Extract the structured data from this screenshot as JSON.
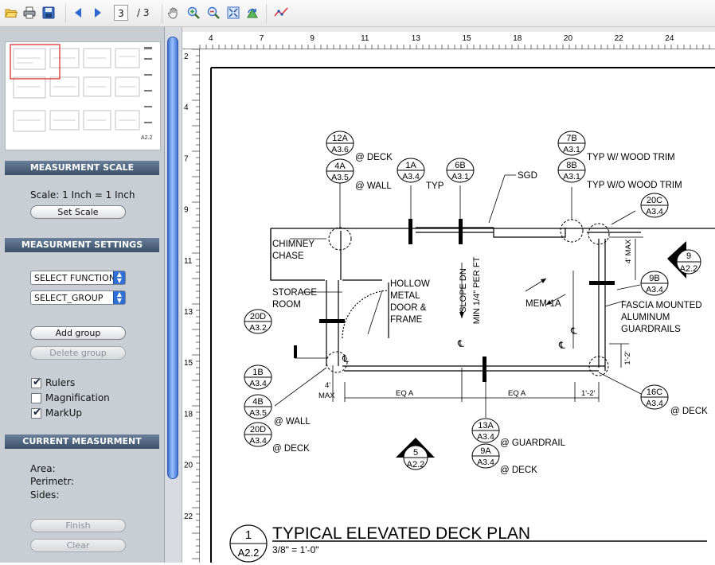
{
  "toolbar": {
    "current_page": "3",
    "total_pages": "/ 3",
    "icons": [
      "folder-open-icon",
      "print-icon",
      "save-icon",
      "previous-page-icon",
      "next-page-icon",
      "pan-hand-icon",
      "zoom-in-icon",
      "zoom-out-icon",
      "fit-page-icon",
      "rotate-icon",
      "measure-icon"
    ]
  },
  "thumbnail": {
    "sheet_label": "A2.2"
  },
  "measurement_scale": {
    "header": "MEASURMENT SCALE",
    "scale_text": "Scale: 1 Inch = 1 Inch",
    "set_scale_label": "Set Scale"
  },
  "measurement_settings": {
    "header": "MEASURMENT SETTINGS",
    "function_select": "SELECT FUNCTION",
    "group_select": "SELECT_GROUP",
    "add_group_label": "Add group",
    "delete_group_label": "Delete group",
    "checkboxes": [
      {
        "label": "Rulers",
        "checked": true
      },
      {
        "label": "Magnification",
        "checked": false
      },
      {
        "label": "MarkUp",
        "checked": true
      }
    ]
  },
  "current_measurement": {
    "header": "CURRENT MEASURMENT",
    "area_label": "Area:",
    "perimeter_label": "Perimetr:",
    "sides_label": "Sides:",
    "finish_label": "Finish",
    "clear_label": "Clear"
  },
  "rulers": {
    "top_labels": [
      "4",
      "7",
      "9",
      "11",
      "13",
      "15",
      "18",
      "20",
      "22",
      "24"
    ],
    "left_labels": [
      "2",
      "4",
      "7",
      "9",
      "11",
      "13",
      "15",
      "18",
      "20",
      "22"
    ]
  },
  "drawing": {
    "tags": [
      {
        "top": "12A",
        "bottom": "A3.6"
      },
      {
        "top": "4A",
        "bottom": "A3.5"
      },
      {
        "top": "1A",
        "bottom": "A3.4"
      },
      {
        "top": "6B",
        "bottom": "A3.1"
      },
      {
        "top": "7B",
        "bottom": "A3.1"
      },
      {
        "top": "8B",
        "bottom": "A3.1"
      },
      {
        "top": "20C",
        "bottom": "A3.4"
      },
      {
        "top": "9B",
        "bottom": "A3.4"
      },
      {
        "top": "20D",
        "bottom": "A3.2"
      },
      {
        "top": "1B",
        "bottom": "A3.4"
      },
      {
        "top": "4B",
        "bottom": "A3.5"
      },
      {
        "top": "20D",
        "bottom": "A3.4"
      },
      {
        "top": "13A",
        "bottom": "A3.4"
      },
      {
        "top": "9A",
        "bottom": "A3.4"
      },
      {
        "top": "16C",
        "bottom": "A3.4"
      }
    ],
    "notes": {
      "at_deck_1": "@ DECK",
      "at_wall_1": "@ WALL",
      "typ": "TYP",
      "sgd": "SGD",
      "typ_wood": "TYP W/ WOOD TRIM",
      "typ_wo_wood": "TYP W/O WOOD TRIM",
      "chimney_1": "CHIMNEY",
      "chimney_2": "CHASE",
      "storage_1": "STORAGE",
      "storage_2": "ROOM",
      "hollow_1": "HOLLOW",
      "hollow_2": "METAL",
      "hollow_3": "DOOR &",
      "hollow_4": "FRAME",
      "slope_1": "SLOPE DN",
      "slope_2": "MIN 1/4\" PER FT",
      "mem": "MEM-1A",
      "fascia_1": "FASCIA MOUNTED",
      "fascia_2": "ALUMINUM",
      "fascia_3": "GUARDRAILS",
      "four_max_v": "4' MAX",
      "four": "4'",
      "max": "MAX",
      "eq_a_1": "EQ A",
      "eq_a_2": "EQ A",
      "one_two_a": "1'-2'",
      "one_two_b": "1'-2'",
      "at_wall_2": "@ WALL",
      "at_deck_2": "@ DECK",
      "at_guardrail": "@ GUARDRAIL",
      "at_deck_3": "@ DECK",
      "at_deck_4": "@ DECK",
      "cl": "℄"
    },
    "section_markers": [
      {
        "top": "9",
        "bottom": "A2.2"
      },
      {
        "top": "5",
        "bottom": "A2.2"
      }
    ],
    "title_number": "1",
    "title_sheet": "A2.2",
    "title": "TYPICAL ELEVATED DECK PLAN",
    "scale": "3/8\" = 1'-0\""
  }
}
